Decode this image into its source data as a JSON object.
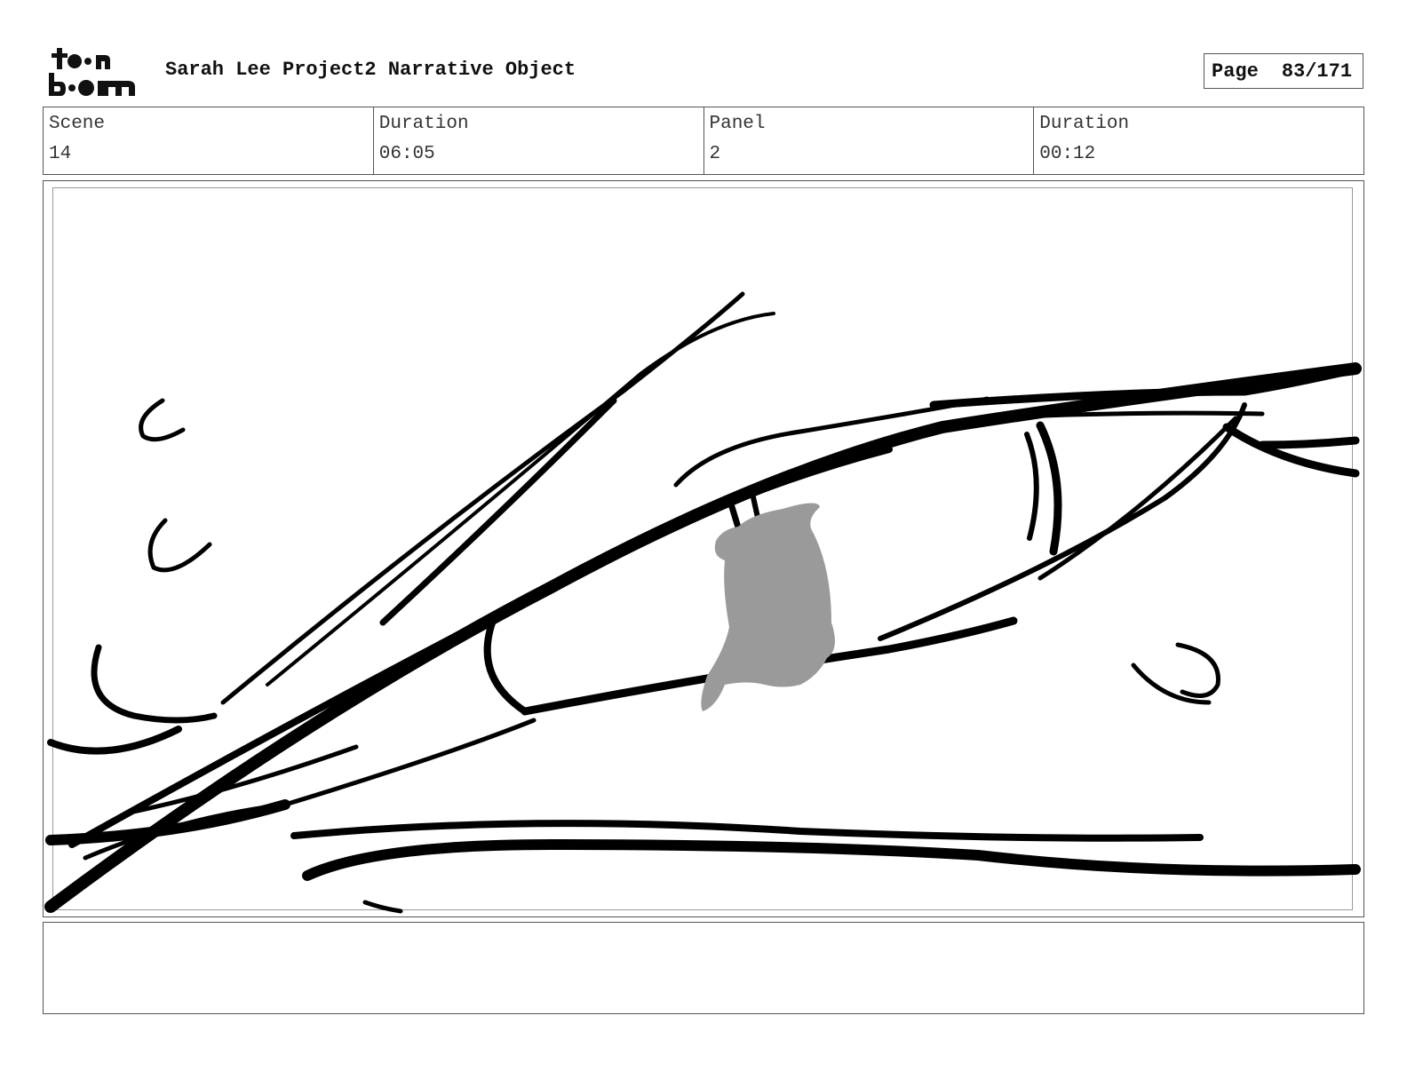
{
  "header": {
    "logo_text": "toon boom",
    "project_title": "Sarah Lee Project2 Narrative Object",
    "page_label": "Page",
    "page_value": "83/171"
  },
  "info": {
    "scene_label": "Scene",
    "scene_value": "14",
    "scene_duration_label": "Duration",
    "scene_duration_value": "06:05",
    "panel_label": "Panel",
    "panel_value": "2",
    "panel_duration_label": "Duration",
    "panel_duration_value": "00:12"
  },
  "panel": {
    "subject": "sketch-eye-closeup-with-silhouette",
    "ink_color": "#000000",
    "silhouette_color": "#9a9a9a"
  },
  "notes": {
    "text": ""
  }
}
